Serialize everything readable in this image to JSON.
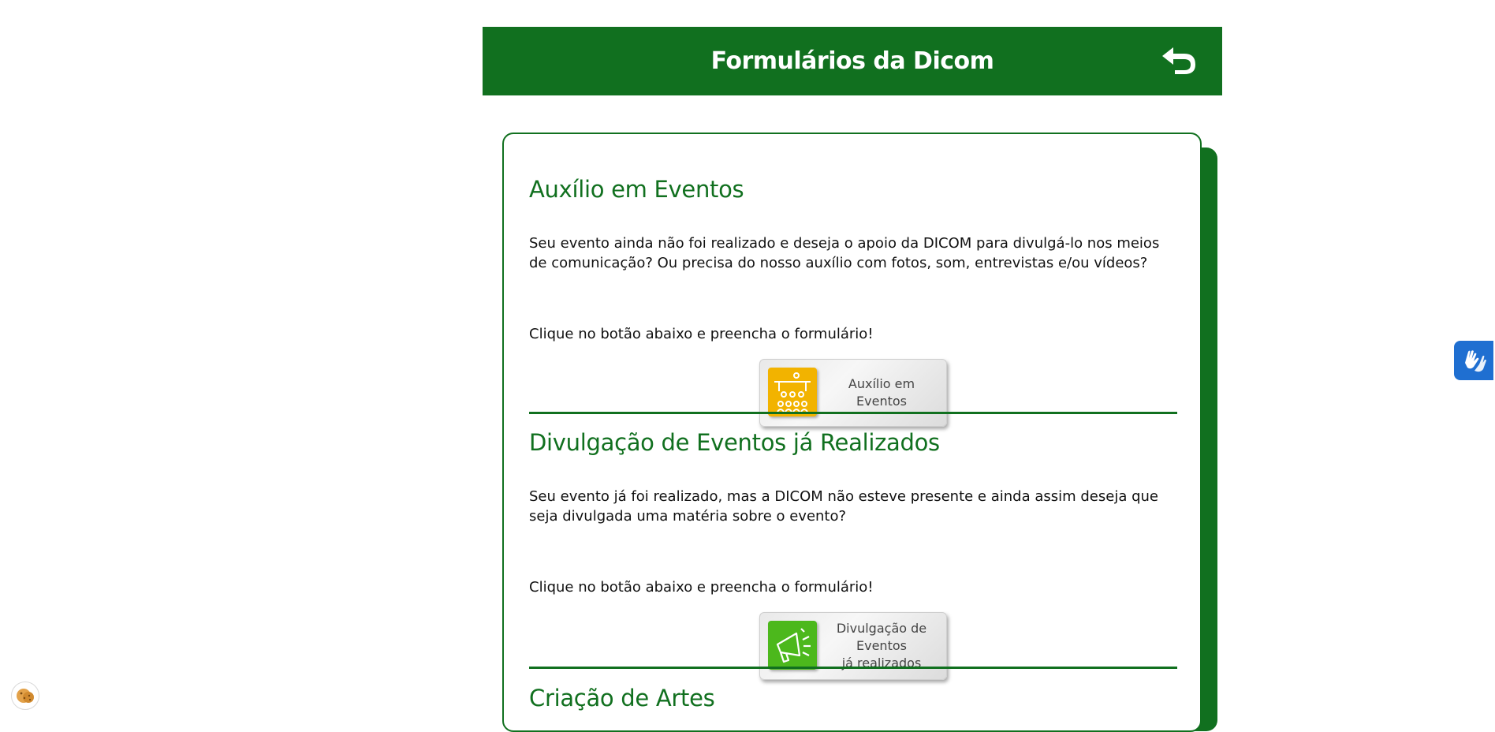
{
  "header": {
    "title": "Formulários da Dicom"
  },
  "sections": [
    {
      "title": "Auxílio em Eventos",
      "description": "Seu evento ainda não foi realizado e deseja o apoio da DICOM para divulgá-lo nos meios de comunicação? Ou precisa do nosso auxílio com fotos, som, entrevistas e/ou vídeos?",
      "cta": "Clique no botão abaixo e preencha o formulário!",
      "button_label": "Auxílio em Eventos",
      "button_icon": "event-audience-icon",
      "icon_color": "#f2b300"
    },
    {
      "title": "Divulgação de Eventos já Realizados",
      "description": "Seu evento já foi realizado, mas a DICOM não esteve presente e ainda assim deseja que seja divulgada uma matéria sobre o evento?",
      "cta": "Clique no botão abaixo e preencha o formulário!",
      "button_label": "Divulgação de\nEventos\njá realizados",
      "button_icon": "megaphone-icon",
      "icon_color": "#4cb81c"
    },
    {
      "title": "Criação de Artes"
    }
  ],
  "colors": {
    "brand_green": "#11701f",
    "vlibras_blue": "#1f6fd1"
  }
}
